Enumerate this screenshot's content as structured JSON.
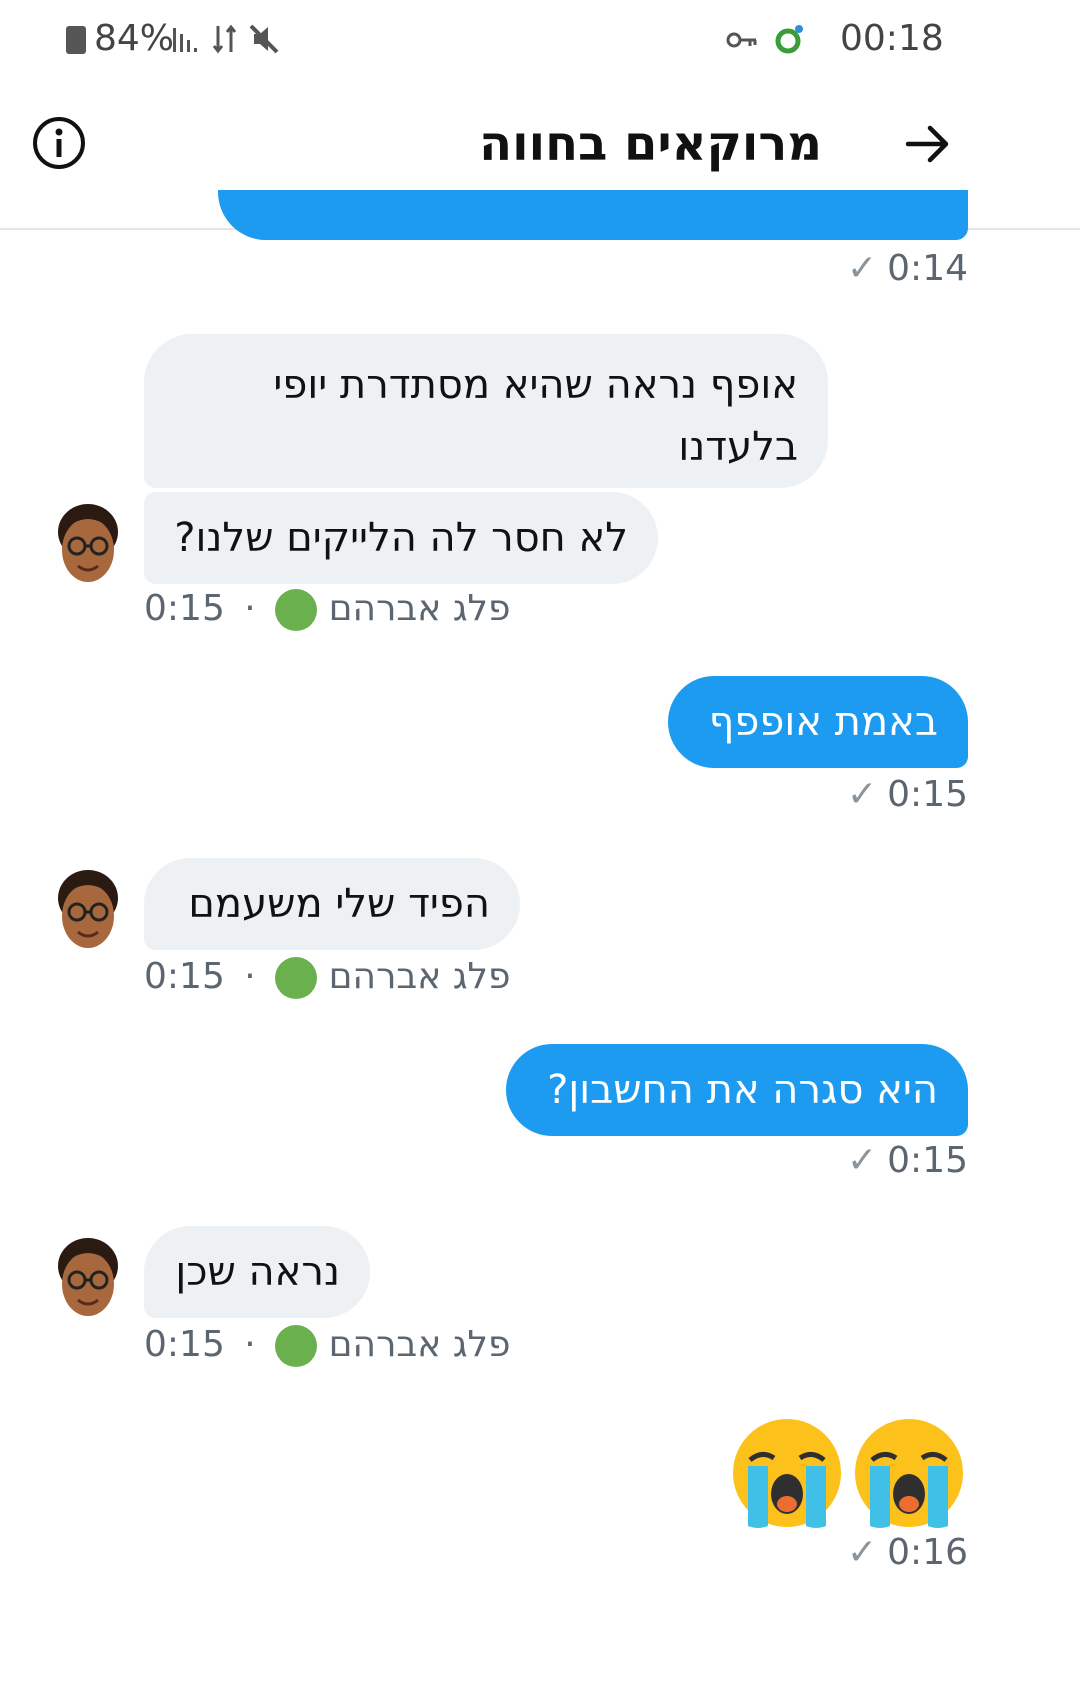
{
  "status_bar": {
    "battery": "84%",
    "time": "00:18",
    "icons": [
      "battery-icon",
      "signal-icon",
      "data-arrows-icon",
      "mute-icon",
      "vpn-key-icon",
      "app-status-icon"
    ]
  },
  "header": {
    "title": "מרוקאים בחווה",
    "back_icon": "arrow-right-icon",
    "info_icon": "info-icon"
  },
  "messages": [
    {
      "dir": "out",
      "text": "",
      "time": "0:14",
      "check": "✓",
      "partial": true
    },
    {
      "dir": "in",
      "text": "אופף נראה שהיא מסתדרת יופי בלעדנו",
      "group": "start"
    },
    {
      "dir": "in",
      "text": "לא חסר לה הלייקים שלנו?",
      "sender": "פלג אברהם",
      "time": "0:15"
    },
    {
      "dir": "out",
      "text": "באמת אופפף",
      "time": "0:15",
      "check": "✓"
    },
    {
      "dir": "in",
      "text": "הפיד שלי משעמם",
      "sender": "פלג אברהם",
      "time": "0:15"
    },
    {
      "dir": "out",
      "text": "היא סגרה את החשבון?",
      "time": "0:15",
      "check": "✓"
    },
    {
      "dir": "in",
      "text": "נראה שכן",
      "sender": "פלג אברהם",
      "time": "0:15"
    },
    {
      "dir": "out",
      "emoji": [
        "loudly-crying-face",
        "loudly-crying-face"
      ],
      "time": "0:16",
      "check": "✓"
    }
  ],
  "separator": "·",
  "colors": {
    "bubble_out": "#1d9bf0",
    "bubble_in": "#eef1f3",
    "online": "#6ab04c"
  }
}
